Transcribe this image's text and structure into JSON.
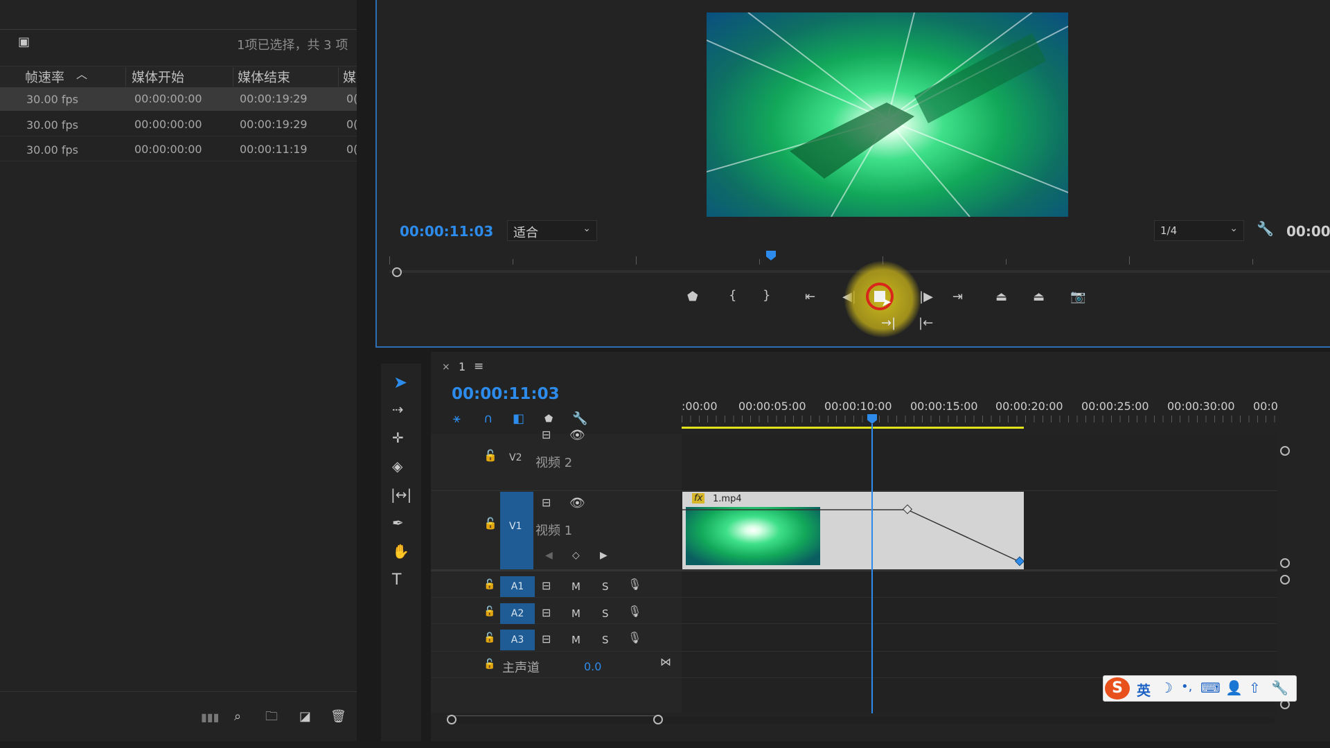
{
  "project_panel": {
    "selection_status": "1项已选择，共 3 项",
    "columns": [
      "帧速率",
      "媒体开始",
      "媒体结束",
      "媒"
    ],
    "rows": [
      {
        "fps": "30.00 fps",
        "start": "00:00:00:00",
        "end": "00:00:19:29",
        "more": "0("
      },
      {
        "fps": "30.00 fps",
        "start": "00:00:00:00",
        "end": "00:00:19:29",
        "more": "0("
      },
      {
        "fps": "30.00 fps",
        "start": "00:00:00:00",
        "end": "00:00:11:19",
        "more": "0("
      }
    ],
    "selected_row": 0
  },
  "program_monitor": {
    "timecode": "00:00:11:03",
    "fit_label": "适合",
    "resolution": "1/4",
    "right_timecode": "00:00",
    "playhead_fraction": 0.4
  },
  "timeline": {
    "sequence_name": "1",
    "timecode": "00:00:11:03",
    "ruler_labels": [
      ":00:00",
      "00:00:05:00",
      "00:00:10:00",
      "00:00:15:00",
      "00:00:20:00",
      "00:00:25:00",
      "00:00:30:00",
      "00:0"
    ],
    "tracks": {
      "v2": {
        "id": "V2",
        "name": "视频 2"
      },
      "v1": {
        "id": "V1",
        "name": "视频 1"
      },
      "a1": "A1",
      "a2": "A2",
      "a3": "A3",
      "master": {
        "name": "主声道",
        "value": "0.0"
      }
    },
    "clip": {
      "name": "1.mp4",
      "fx": "fx"
    },
    "mute": "M",
    "solo": "S"
  },
  "ime_toolbar": {
    "lang": "英"
  },
  "colors": {
    "accent": "#2d8ceb",
    "track_selected": "#1f5c96",
    "clip": "#d4d4d4",
    "work_area": "#e3e31a"
  }
}
